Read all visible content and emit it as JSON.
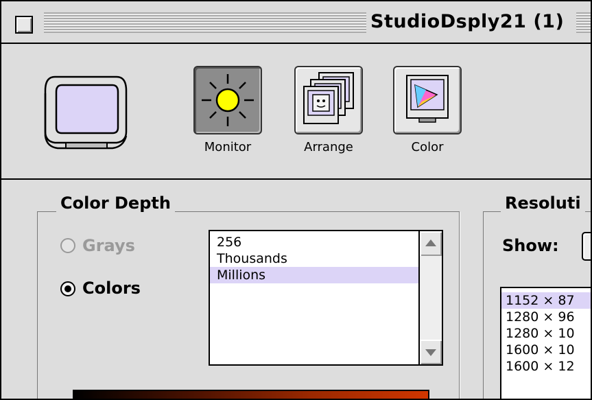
{
  "window": {
    "title": "StudioDsply21 (1)"
  },
  "toolbar": {
    "buttons": [
      {
        "label": "Monitor",
        "selected": true
      },
      {
        "label": "Arrange",
        "selected": false
      },
      {
        "label": "Color",
        "selected": false
      }
    ]
  },
  "color_depth": {
    "title": "Color Depth",
    "grays_label": "Grays",
    "colors_label": "Colors",
    "selected_mode": "Colors",
    "depth_options": [
      "256",
      "Thousands",
      "Millions"
    ],
    "selected_depth": "Millions"
  },
  "resolution": {
    "title": "Resoluti",
    "show_label": "Show:",
    "items": [
      "1152 × 87",
      "1280 × 96",
      "1280 × 10",
      "1600 × 10",
      "1600 × 12"
    ],
    "selected_index": 0
  },
  "colors": {
    "selection": "#dcd4f7",
    "window_bg": "#dddddd",
    "sun": "#ffff00",
    "screen": "#dcd4f7"
  }
}
